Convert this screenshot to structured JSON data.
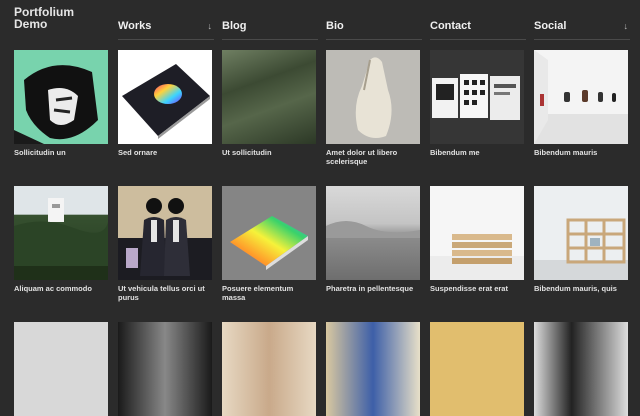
{
  "logo": "Portfolium Demo",
  "nav": [
    {
      "label": "Works",
      "has_dropdown": true
    },
    {
      "label": "Blog",
      "has_dropdown": false
    },
    {
      "label": "Bio",
      "has_dropdown": false
    },
    {
      "label": "Contact",
      "has_dropdown": false
    },
    {
      "label": "Social",
      "has_dropdown": true
    }
  ],
  "dropdown_icon": "chevron-down-icon",
  "row1": [
    {
      "caption": "Sollicitudin un"
    },
    {
      "caption": "Sed ornare"
    },
    {
      "caption": "Ut sollicitudin"
    },
    {
      "caption": "Amet dolor ut libero scelerisque"
    },
    {
      "caption": "Bibendum me"
    },
    {
      "caption": "Bibendum mauris"
    }
  ],
  "row2": [
    {
      "caption": "Aliquam ac commodo"
    },
    {
      "caption": "Ut vehicula tellus orci ut purus"
    },
    {
      "caption": "Posuere elementum massa"
    },
    {
      "caption": "Pharetra in pellentesque"
    },
    {
      "caption": "Suspendisse erat erat"
    },
    {
      "caption": "Bibendum mauris, quis"
    }
  ]
}
